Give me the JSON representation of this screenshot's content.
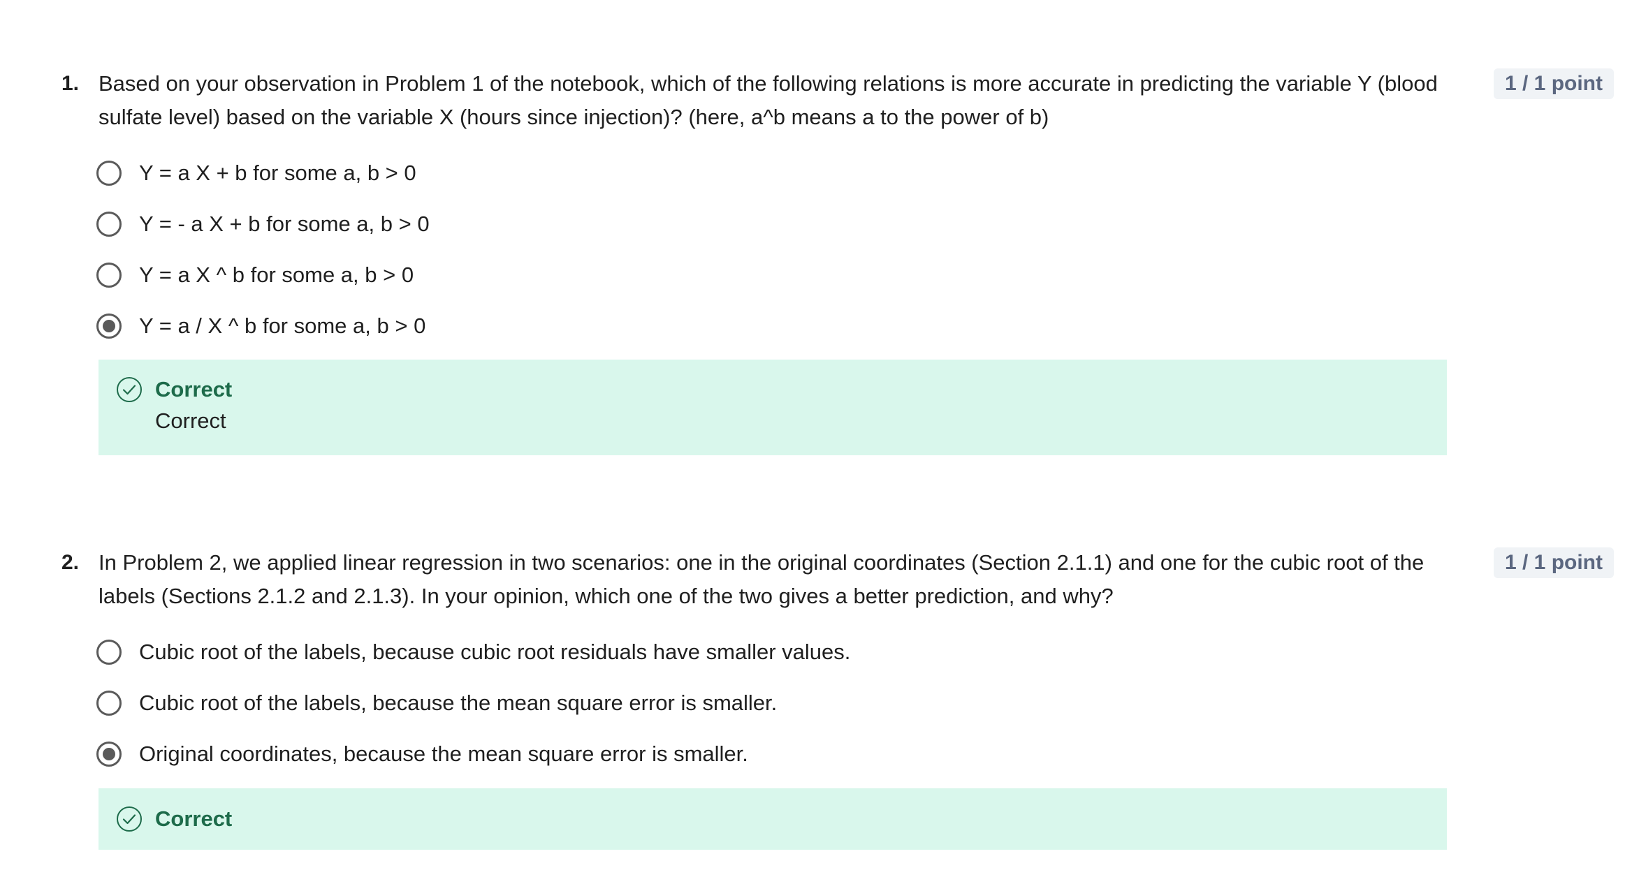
{
  "questions": [
    {
      "number": "1.",
      "text": "Based on your observation in Problem 1 of the notebook, which of the following relations is more accurate in predicting the variable Y (blood sulfate level) based on the variable X (hours since injection)? (here, a^b means a to the power of b)",
      "points": "1 / 1 point",
      "options": [
        {
          "label": "Y = a X + b for some a, b > 0",
          "selected": false
        },
        {
          "label": "Y = - a X + b for some a, b > 0",
          "selected": false
        },
        {
          "label": "Y = a X ^ b for some a, b > 0",
          "selected": false
        },
        {
          "label": "Y = a / X ^ b for some a, b > 0",
          "selected": true
        }
      ],
      "feedback": {
        "title": "Correct",
        "text": "Correct",
        "icon": "check-circle-icon",
        "color": "#1d6b4a",
        "background": "#d9f7ec"
      }
    },
    {
      "number": "2.",
      "text": "In Problem 2, we applied linear regression in two scenarios: one in the original coordinates (Section 2.1.1) and one for the cubic root of the labels (Sections 2.1.2 and 2.1.3). In your opinion, which one of the two gives a better prediction, and why?",
      "points": "1 / 1 point",
      "options": [
        {
          "label": "Cubic root of the labels, because cubic root residuals have smaller values.",
          "selected": false
        },
        {
          "label": "Cubic root of the labels, because the mean square error is smaller.",
          "selected": false
        },
        {
          "label": "Original coordinates, because the mean square error is smaller.",
          "selected": true
        }
      ],
      "feedback": {
        "title": "Correct",
        "icon": "check-circle-icon",
        "color": "#1d6b4a",
        "background": "#d9f7ec"
      }
    }
  ]
}
